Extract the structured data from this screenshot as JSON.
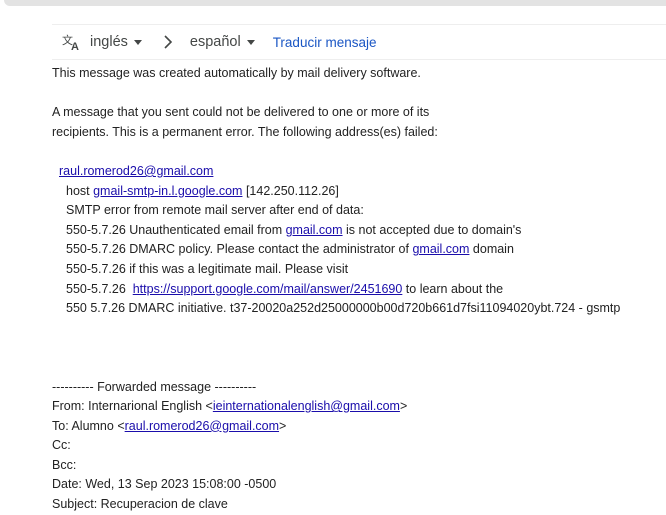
{
  "translate": {
    "source_lang": "inglés",
    "target_lang": "español",
    "action": "Traducir mensaje"
  },
  "message": {
    "auto_note": "This message was created automatically by mail delivery software.",
    "error_line1": "A message that you sent could not be delivered to one or more of its",
    "error_line2": "recipients. This is a permanent error. The following address(es) failed:",
    "failed_address": "raul.romerod26@gmail.com",
    "host_prefix": "host ",
    "host_link": "gmail-smtp-in.l.google.com",
    "host_ip": " [142.250.112.26]",
    "smtp_error": "SMTP error from remote mail server after end of data:",
    "l550_1a": "550-5.7.26 Unauthenticated email from ",
    "l550_1_link": "gmail.com",
    "l550_1b": " is not accepted due to domain's",
    "l550_2a": "550-5.7.26 DMARC policy. Please contact the administrator of ",
    "l550_2_link": "gmail.com",
    "l550_2b": " domain",
    "l550_3": "550-5.7.26 if this was a legitimate mail. Please visit",
    "l550_4a": "550-5.7.26  ",
    "l550_4_link": "https://support.google.com/mail/answer/2451690",
    "l550_4b": " to learn about the",
    "l550_5": "550 5.7.26 DMARC initiative. t37-20020a252d25000000b00d720b661d7fsi11094020ybt.724 - gsmtp"
  },
  "forwarded": {
    "header": "---------- Forwarded message ----------",
    "from_label": "From: Internarional English <",
    "from_email": "ieinternationalenglish@gmail.com",
    "from_close": ">",
    "to_label": "To: Alumno <",
    "to_email": "raul.romerod26@gmail.com",
    "to_close": ">",
    "cc": "Cc:",
    "bcc": "Bcc:",
    "date": "Date: Wed, 13 Sep 2023 15:08:00 -0500",
    "subject": "Subject: Recuperacion de clave"
  },
  "colors": {
    "link": "#1a0dab",
    "translate_link": "#1a56c4"
  }
}
